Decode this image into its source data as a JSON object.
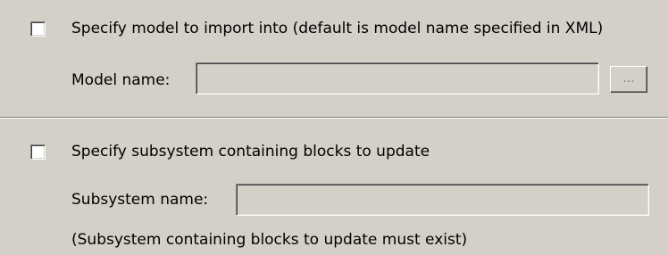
{
  "model_section": {
    "checkbox_label": "Specify model to import into (default is model name specified in XML)",
    "checked": false,
    "name_label": "Model name:",
    "name_value": "",
    "browse_label": "..."
  },
  "subsystem_section": {
    "checkbox_label": "Specify subsystem containing blocks to update",
    "checked": false,
    "name_label": "Subsystem name:",
    "name_value": "",
    "note": "(Subsystem containing blocks to update must exist)"
  }
}
